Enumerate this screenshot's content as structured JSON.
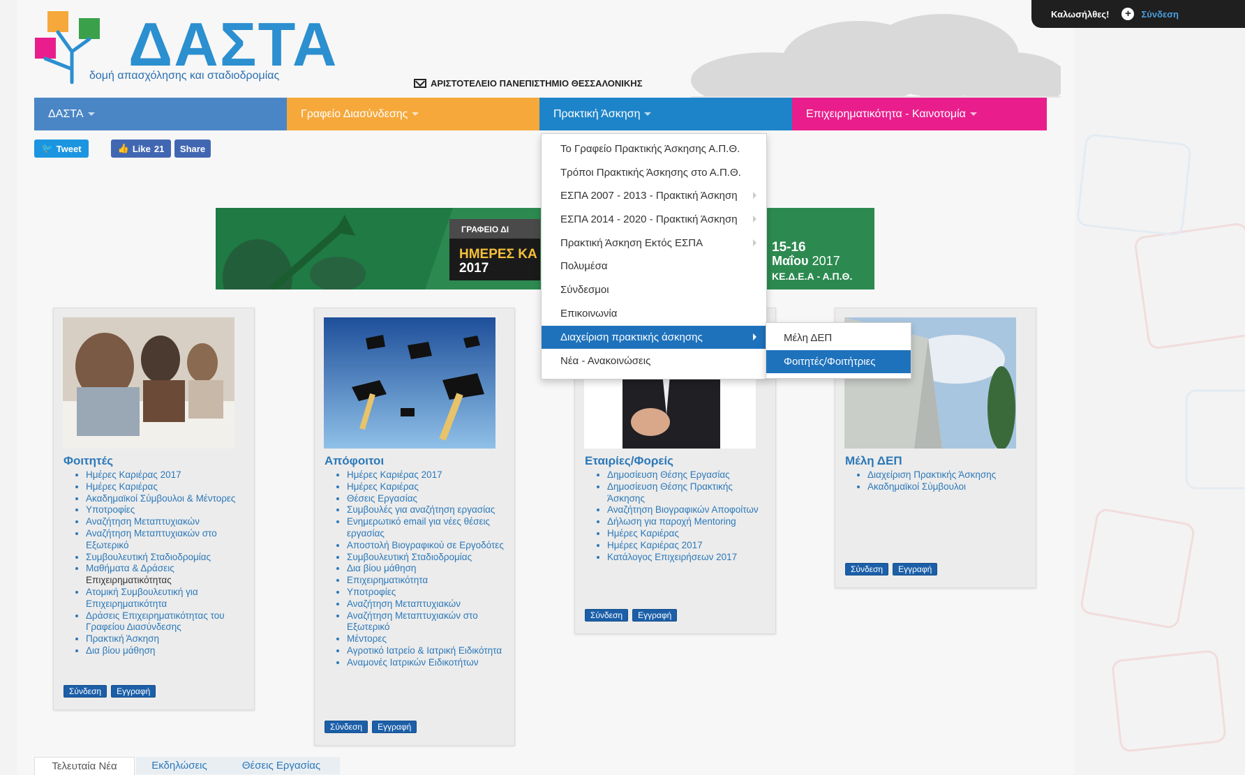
{
  "topbar": {
    "welcome": "Καλωσήλθες!",
    "login": "Σύνδεση"
  },
  "logo": {
    "title": "ΔΑΣΤΑ",
    "subtitle": "δομή απασχόλησης και σταδιοδρομίας"
  },
  "university": "ΑΡΙΣΤΟΤΕΛΕΙΟ ΠΑΝΕΠΙΣΤΗΜΙΟ ΘΕΣΣΑΛΟΝΙΚΗΣ",
  "nav": [
    {
      "label": "ΔΑΣΤΑ",
      "color": "#4a86c5"
    },
    {
      "label": "Γραφείο Διασύνδεσης",
      "color": "#f6a83b"
    },
    {
      "label": "Πρακτική Άσκηση",
      "color": "#1e84c9"
    },
    {
      "label": "Επιχειρηματικότητα - Καινοτομία",
      "color": "#e91e8c"
    }
  ],
  "social": {
    "tweet": "Tweet",
    "like": "Like",
    "like_count": "21",
    "share": "Share"
  },
  "banner": {
    "office": "ΓΡΑΦΕΙΟ ΔΙ",
    "days": "ΗΜΕΡΕΣ ΚΑ",
    "year": "2017",
    "dates": "15-16",
    "month": "Μαΐου",
    "month_year": "2017",
    "venue": "ΚΕ.Δ.Ε.Α - Α.Π.Θ."
  },
  "dropdown": {
    "items": [
      "Το Γραφείο Πρακτικής Άσκησης Α.Π.Θ.",
      "Τρόποι Πρακτικής Άσκησης στο Α.Π.Θ.",
      "ΕΣΠΑ 2007 - 2013 - Πρακτική Άσκηση",
      "ΕΣΠΑ 2014 - 2020 - Πρακτική Άσκηση",
      "Πρακτική Άσκηση Εκτός ΕΣΠΑ",
      "Πολυμέσα",
      "Σύνδεσμοι",
      "Επικοινωνία",
      "Διαχείριση πρακτικής άσκησης",
      "Νέα - Ανακοινώσεις"
    ],
    "submenu": [
      "Μέλη ΔΕΠ",
      "Φοιτητές/Φοιτήτριες"
    ]
  },
  "cards": [
    {
      "title": "Φοιτητές",
      "items": [
        "Ημέρες Καριέρας 2017",
        "Ημέρες Καριέρας",
        "Ακαδημαϊκοί Σύμβουλοι & Μέντορες",
        "Υποτροφίες",
        "Αναζήτηση Μεταπτυχιακών",
        "Αναζήτηση Μεταπτυχιακών στο Εξωτερικό",
        "Συμβουλευτική Σταδιοδρομίας",
        "Μαθήματα & Δράσεις",
        "Επιχειρηματικότητας",
        "Ατομική Συμβουλευτική για Επιχειρηματικότητα",
        "Δράσεις Επιχειρηματικότητας του Γραφείου Διασύνδεσης",
        "Πρακτική Άσκηση",
        "Δια βίου μάθηση"
      ],
      "login": "Σύνδεση",
      "register": "Εγγραφή"
    },
    {
      "title": "Απόφοιτοι",
      "items": [
        "Ημέρες Καριέρας 2017",
        "Ημέρες Καριέρας",
        "Θέσεις Εργασίας",
        "Συμβουλές για αναζήτηση εργασίας",
        "Ενημερωτικό email για νέες θέσεις εργασίας",
        "Αποστολή Βιογραφικού σε Εργοδότες",
        "Συμβουλευτική Σταδιοδρομίας",
        "Δια βίου μάθηση",
        "Επιχειρηματικότητα",
        "Υποτροφίες",
        "Αναζήτηση Μεταπτυχιακών",
        "Αναζήτηση Μεταπτυχιακών στο Εξωτερικό",
        "Μέντορες",
        "Αγροτικό Ιατρείο & Ιατρική Ειδικότητα",
        "Αναμονές Ιατρικών Ειδικοτήτων"
      ],
      "login": "Σύνδεση",
      "register": "Εγγραφή"
    },
    {
      "title": "Εταιρίες/Φορείς",
      "items": [
        "Δημοσίευση Θέσης Εργασίας",
        "Δημοσίευση Θέσης Πρακτικής Άσκησης",
        "Αναζήτηση Βιογραφικών Αποφοίτων",
        "Δήλωση για παροχή Mentoring",
        "Ημέρες Καριέρας",
        "Ημέρες Καριέρας 2017",
        "Κατάλογος Επιχειρήσεων 2017"
      ],
      "login": "Σύνδεση",
      "register": "Εγγραφή"
    },
    {
      "title": "Μέλη ΔΕΠ",
      "items": [
        "Διαχείριση Πρακτικής Άσκησης",
        "Ακαδημαϊκοί Σύμβουλοι"
      ],
      "login": "Σύνδεση",
      "register": "Εγγραφή"
    }
  ],
  "tabs": [
    "Τελευταία Νέα",
    "Εκδηλώσεις",
    "Θέσεις Εργασίας"
  ]
}
